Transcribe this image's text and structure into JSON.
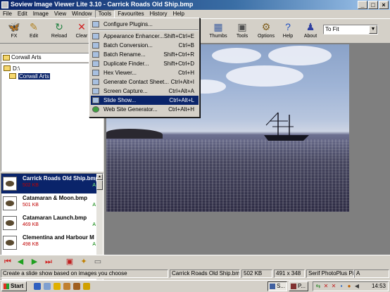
{
  "window": {
    "title": "Soview Image Viewer Lite 3.10 - Carrick Roads Old Ship.bmp",
    "controls": [
      "_",
      "□",
      "×"
    ]
  },
  "menubar": [
    "File",
    "Edit",
    "Image",
    "View",
    "Window",
    "Tools",
    "Favourites",
    "History",
    "Help"
  ],
  "toolbar": {
    "buttons": [
      {
        "label": "FX",
        "icon": "butterfly-icon"
      },
      {
        "label": "Edit",
        "icon": "pencil-icon"
      },
      {
        "label": "Reload",
        "icon": "reload-icon"
      },
      {
        "label": "Clear",
        "icon": "clear-icon"
      },
      {
        "label": "Thumbs",
        "icon": "thumbs-icon"
      },
      {
        "label": "Tools",
        "icon": "tools-icon"
      },
      {
        "label": "Options",
        "icon": "options-icon"
      },
      {
        "label": "Help",
        "icon": "help-icon"
      },
      {
        "label": "About",
        "icon": "about-icon"
      }
    ],
    "zoom_select": "To Fit"
  },
  "tools_menu": {
    "items": [
      {
        "label": "Configure Plugins...",
        "shortcut": ""
      },
      {
        "label": "Appearance Enhancer...",
        "shortcut": "Shift+Ctrl+E"
      },
      {
        "label": "Batch Conversion...",
        "shortcut": "Ctrl+B"
      },
      {
        "label": "Batch Rename...",
        "shortcut": "Shift+Ctrl+R"
      },
      {
        "label": "Duplicate Finder...",
        "shortcut": "Shift+Ctrl+D"
      },
      {
        "label": "Hex Viewer...",
        "shortcut": "Ctrl+H"
      },
      {
        "label": "Generate Contact Sheet...",
        "shortcut": "Ctrl+Alt+I"
      },
      {
        "label": "Screen Capture...",
        "shortcut": "Ctrl+Alt+A"
      },
      {
        "label": "Slide Show...",
        "shortcut": "Ctrl+Alt+L"
      },
      {
        "label": "Web Site Generator...",
        "shortcut": "Ctrl+Alt+H"
      }
    ],
    "highlighted": "Slide Show..."
  },
  "left_panel": {
    "path_header": "Corwall Arts",
    "drive_combo": "Corwall Arts",
    "tree": [
      {
        "label": "D:\\",
        "selected": false
      },
      {
        "label": "Corwall Arts",
        "selected": true
      }
    ]
  },
  "files": [
    {
      "name": "Carrick Roads Old Ship.bmp",
      "size": "502 KB",
      "attr": "A",
      "selected": true
    },
    {
      "name": "Catamaran & Moon.bmp",
      "size": "501 KB",
      "attr": "A",
      "selected": false
    },
    {
      "name": "Catamaran Launch.bmp",
      "size": "469 KB",
      "attr": "A",
      "selected": false
    },
    {
      "name": "Clementina and Harbour M",
      "size": "498 KB",
      "attr": "A",
      "selected": false
    }
  ],
  "status": {
    "hint": "Create a slide show based on images you choose",
    "filename": "Carrick Roads Old Ship.bmp",
    "filesize": "502 KB",
    "dimensions": "491 x 348",
    "font": "Serif PhotoPlus Pich",
    "attr": "A"
  },
  "taskbar": {
    "start": "Start",
    "tasks": [
      "S...",
      "P..."
    ],
    "clock": "14:53"
  },
  "colors": {
    "title_active": "#0a246a",
    "menu_highlight": "#0a246a",
    "face": "#d4d0c8",
    "file_size_red": "#c00000",
    "attr_green": "#008000"
  }
}
